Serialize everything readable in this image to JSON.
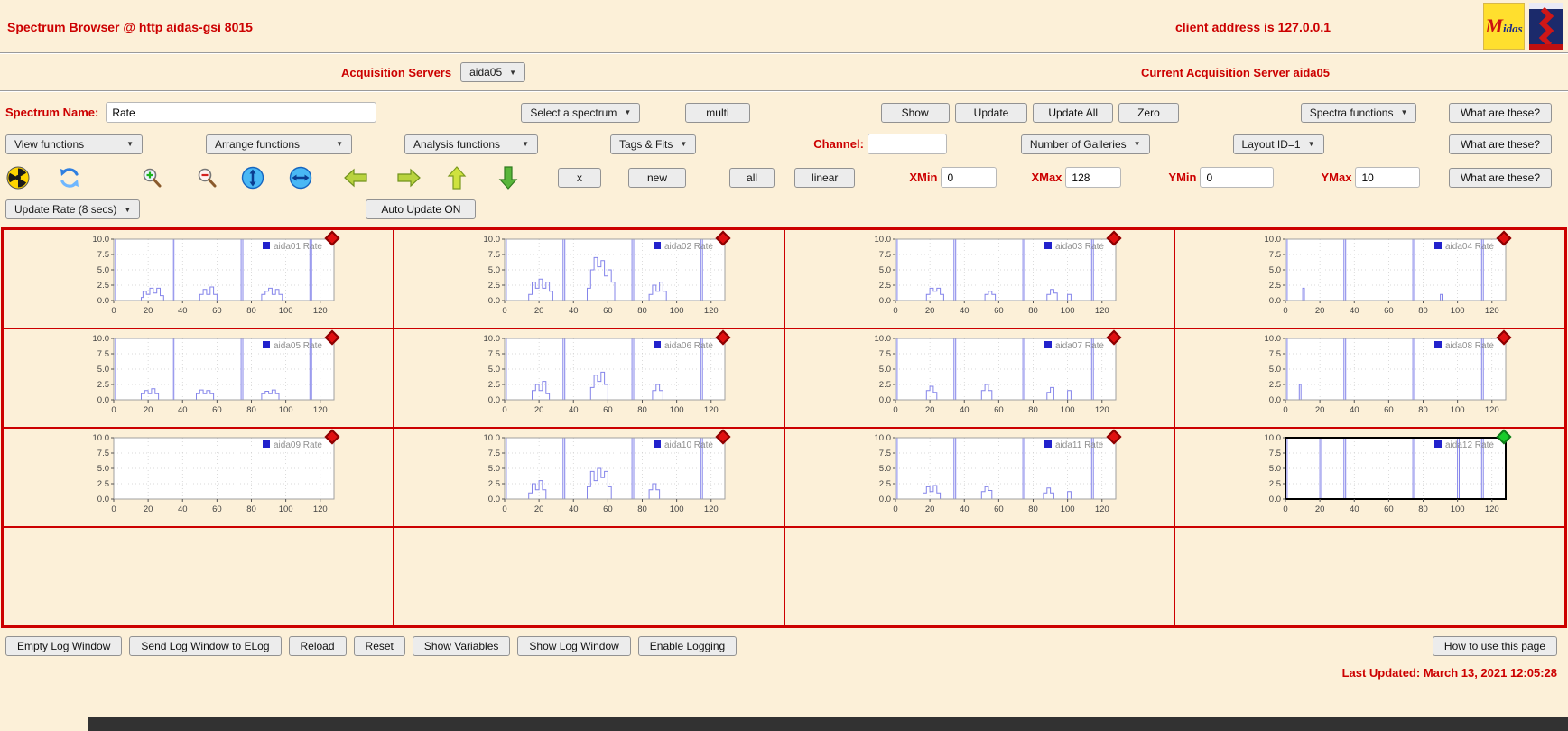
{
  "header": {
    "title": "Spectrum Browser @ http aidas-gsi 8015",
    "client_address": "client address is 127.0.0.1",
    "midas_logo_text": "Midas"
  },
  "icons": {
    "chevron_down": "▼",
    "radiation": "radiation-trefoil",
    "refresh": "circular-arrows",
    "zoom_in": "magnifier-plus",
    "zoom_out": "magnifier-minus",
    "unzoom_y": "↕",
    "unzoom_x": "↔",
    "shift_left": "left-block-arrow",
    "shift_right": "right-block-arrow",
    "shift_up": "up-block-arrow",
    "shift_down": "down-block-arrow"
  },
  "acquisition": {
    "label": "Acquisition Servers",
    "selected_server": "aida05",
    "current_text": "Current Acquisition Server aida05"
  },
  "spectrum_row": {
    "name_label": "Spectrum Name:",
    "name_value": "Rate",
    "select_spectrum": "Select a spectrum",
    "multi": "multi",
    "show": "Show",
    "update": "Update",
    "update_all": "Update All",
    "zero": "Zero",
    "spectra_functions": "Spectra functions",
    "what_are_these": "What are these?"
  },
  "functions_row": {
    "view_functions": "View functions",
    "arrange_functions": "Arrange functions",
    "analysis_functions": "Analysis functions",
    "tags_fits": "Tags & Fits",
    "channel_label": "Channel:",
    "channel_value": "",
    "number_of_galleries": "Number of Galleries",
    "layout_id": "Layout ID=1",
    "what_are_these": "What are these?"
  },
  "toolbar": {
    "x": "x",
    "new": "new",
    "all": "all",
    "linear": "linear",
    "xmin_label": "XMin",
    "xmin_value": "0",
    "xmax_label": "XMax",
    "xmax_value": "128",
    "ymin_label": "YMin",
    "ymin_value": "0",
    "ymax_label": "YMax",
    "ymax_value": "10",
    "what_are_these": "What are these?"
  },
  "update_row": {
    "update_rate": "Update Rate (8 secs)",
    "auto_update": "Auto Update ON"
  },
  "footer": {
    "buttons": [
      "Empty Log Window",
      "Send Log Window to ELog",
      "Reload",
      "Reset",
      "Show Variables",
      "Show Log Window",
      "Enable Logging"
    ],
    "help_button": "How to use this page",
    "last_updated": "Last Updated: March 13, 2021 12:05:28"
  },
  "chart_data": {
    "type": "step-line",
    "xlim": [
      0,
      128
    ],
    "ylim": [
      0,
      10
    ],
    "xticks": [
      0,
      20,
      40,
      60,
      80,
      100,
      120
    ],
    "yticks": [
      0,
      2.5,
      5,
      7.5,
      10
    ],
    "xlabel": "",
    "ylabel": "",
    "grid": true,
    "legend_position": "top-right",
    "line_color": "#8484ea",
    "legend_square_color": "#2222cc",
    "marker_colors": {
      "red": "#e01010",
      "green": "#18cc2a"
    },
    "empty_cells": 4,
    "panels": [
      {
        "name": "aida01",
        "legend": "aida01 Rate",
        "marker": "red",
        "selected": false,
        "points": [
          [
            0,
            10
          ],
          [
            1,
            0
          ],
          [
            16,
            0.5
          ],
          [
            17,
            1.5
          ],
          [
            19,
            1
          ],
          [
            21,
            2
          ],
          [
            23,
            1.2
          ],
          [
            25,
            2
          ],
          [
            27,
            0.8
          ],
          [
            29,
            0
          ],
          [
            34,
            10
          ],
          [
            35,
            0
          ],
          [
            50,
            1
          ],
          [
            52,
            1.8
          ],
          [
            54,
            1
          ],
          [
            56,
            2.2
          ],
          [
            58,
            1
          ],
          [
            60,
            0
          ],
          [
            74,
            10
          ],
          [
            75,
            0
          ],
          [
            86,
            1
          ],
          [
            88,
            1.5
          ],
          [
            90,
            2
          ],
          [
            92,
            1
          ],
          [
            94,
            1.8
          ],
          [
            96,
            1
          ],
          [
            98,
            0
          ],
          [
            114,
            10
          ],
          [
            115,
            0
          ],
          [
            128,
            0
          ]
        ]
      },
      {
        "name": "aida02",
        "legend": "aida02 Rate",
        "marker": "red",
        "selected": false,
        "points": [
          [
            0,
            10
          ],
          [
            1,
            0
          ],
          [
            14,
            1
          ],
          [
            16,
            3
          ],
          [
            18,
            2
          ],
          [
            20,
            3.5
          ],
          [
            22,
            2
          ],
          [
            24,
            3
          ],
          [
            26,
            1.5
          ],
          [
            28,
            0
          ],
          [
            34,
            10
          ],
          [
            35,
            0
          ],
          [
            48,
            2
          ],
          [
            50,
            5
          ],
          [
            52,
            7
          ],
          [
            54,
            5.5
          ],
          [
            56,
            6.5
          ],
          [
            58,
            4
          ],
          [
            60,
            5
          ],
          [
            62,
            3
          ],
          [
            64,
            0
          ],
          [
            74,
            10
          ],
          [
            75,
            0
          ],
          [
            84,
            1
          ],
          [
            86,
            2.5
          ],
          [
            88,
            1.5
          ],
          [
            90,
            3
          ],
          [
            92,
            1.5
          ],
          [
            94,
            0
          ],
          [
            114,
            10
          ],
          [
            115,
            0
          ],
          [
            128,
            0
          ]
        ]
      },
      {
        "name": "aida03",
        "legend": "aida03 Rate",
        "marker": "red",
        "selected": false,
        "points": [
          [
            0,
            10
          ],
          [
            1,
            0
          ],
          [
            18,
            1
          ],
          [
            20,
            2
          ],
          [
            22,
            1.5
          ],
          [
            24,
            2
          ],
          [
            26,
            1
          ],
          [
            28,
            0
          ],
          [
            34,
            10
          ],
          [
            35,
            0
          ],
          [
            52,
            1
          ],
          [
            54,
            1.5
          ],
          [
            56,
            1
          ],
          [
            58,
            0
          ],
          [
            74,
            10
          ],
          [
            75,
            0
          ],
          [
            88,
            1
          ],
          [
            90,
            1.8
          ],
          [
            92,
            1.2
          ],
          [
            94,
            0
          ],
          [
            100,
            1
          ],
          [
            102,
            0
          ],
          [
            114,
            10
          ],
          [
            115,
            0
          ],
          [
            128,
            0
          ]
        ]
      },
      {
        "name": "aida04",
        "legend": "aida04 Rate",
        "marker": "red",
        "selected": false,
        "points": [
          [
            0,
            10
          ],
          [
            1,
            0
          ],
          [
            10,
            2
          ],
          [
            11,
            0
          ],
          [
            34,
            10
          ],
          [
            35,
            0
          ],
          [
            74,
            10
          ],
          [
            75,
            0
          ],
          [
            90,
            1
          ],
          [
            91,
            0
          ],
          [
            114,
            10
          ],
          [
            115,
            0
          ],
          [
            128,
            0
          ]
        ]
      },
      {
        "name": "aida05",
        "legend": "aida05 Rate",
        "marker": "red",
        "selected": false,
        "points": [
          [
            0,
            10
          ],
          [
            1,
            0
          ],
          [
            16,
            1
          ],
          [
            18,
            1.5
          ],
          [
            20,
            1
          ],
          [
            22,
            1.8
          ],
          [
            24,
            1
          ],
          [
            26,
            0
          ],
          [
            34,
            10
          ],
          [
            35,
            0
          ],
          [
            48,
            1
          ],
          [
            50,
            1.6
          ],
          [
            52,
            1
          ],
          [
            54,
            1.5
          ],
          [
            56,
            1
          ],
          [
            58,
            0
          ],
          [
            74,
            10
          ],
          [
            75,
            0
          ],
          [
            86,
            1
          ],
          [
            88,
            1.4
          ],
          [
            90,
            1
          ],
          [
            92,
            1.6
          ],
          [
            94,
            1
          ],
          [
            96,
            0
          ],
          [
            114,
            10
          ],
          [
            115,
            0
          ],
          [
            128,
            0
          ]
        ]
      },
      {
        "name": "aida06",
        "legend": "aida06 Rate",
        "marker": "red",
        "selected": false,
        "points": [
          [
            0,
            10
          ],
          [
            1,
            0
          ],
          [
            16,
            1.5
          ],
          [
            18,
            2.5
          ],
          [
            20,
            1.5
          ],
          [
            22,
            3
          ],
          [
            24,
            1
          ],
          [
            26,
            0
          ],
          [
            34,
            10
          ],
          [
            35,
            0
          ],
          [
            50,
            2
          ],
          [
            52,
            4
          ],
          [
            54,
            3
          ],
          [
            56,
            4.5
          ],
          [
            58,
            2.5
          ],
          [
            60,
            0
          ],
          [
            74,
            10
          ],
          [
            75,
            0
          ],
          [
            86,
            1.5
          ],
          [
            88,
            2.5
          ],
          [
            90,
            1.5
          ],
          [
            92,
            0
          ],
          [
            114,
            10
          ],
          [
            115,
            0
          ],
          [
            128,
            0
          ]
        ]
      },
      {
        "name": "aida07",
        "legend": "aida07 Rate",
        "marker": "red",
        "selected": false,
        "points": [
          [
            0,
            10
          ],
          [
            1,
            0
          ],
          [
            18,
            1.5
          ],
          [
            20,
            2.2
          ],
          [
            22,
            1.2
          ],
          [
            24,
            0
          ],
          [
            34,
            10
          ],
          [
            35,
            0
          ],
          [
            50,
            1.5
          ],
          [
            52,
            2.5
          ],
          [
            54,
            1.5
          ],
          [
            56,
            0
          ],
          [
            74,
            10
          ],
          [
            75,
            0
          ],
          [
            88,
            1.2
          ],
          [
            90,
            2
          ],
          [
            92,
            0
          ],
          [
            100,
            1.5
          ],
          [
            102,
            0
          ],
          [
            114,
            10
          ],
          [
            115,
            0
          ],
          [
            128,
            0
          ]
        ]
      },
      {
        "name": "aida08",
        "legend": "aida08 Rate",
        "marker": "red",
        "selected": false,
        "points": [
          [
            0,
            10
          ],
          [
            1,
            0
          ],
          [
            8,
            2.5
          ],
          [
            9,
            0
          ],
          [
            34,
            10
          ],
          [
            35,
            0
          ],
          [
            74,
            10
          ],
          [
            75,
            0
          ],
          [
            114,
            10
          ],
          [
            115,
            0
          ],
          [
            128,
            0
          ]
        ]
      },
      {
        "name": "aida09",
        "legend": "aida09 Rate",
        "marker": "red",
        "selected": false,
        "points": []
      },
      {
        "name": "aida10",
        "legend": "aida10 Rate",
        "marker": "red",
        "selected": false,
        "points": [
          [
            0,
            10
          ],
          [
            1,
            0
          ],
          [
            14,
            1
          ],
          [
            16,
            2.5
          ],
          [
            18,
            1.5
          ],
          [
            20,
            3
          ],
          [
            22,
            1.5
          ],
          [
            24,
            0
          ],
          [
            34,
            10
          ],
          [
            35,
            0
          ],
          [
            48,
            2
          ],
          [
            50,
            4.5
          ],
          [
            52,
            3
          ],
          [
            54,
            5
          ],
          [
            56,
            3.5
          ],
          [
            58,
            4.5
          ],
          [
            60,
            2
          ],
          [
            62,
            0
          ],
          [
            74,
            10
          ],
          [
            75,
            0
          ],
          [
            84,
            1.5
          ],
          [
            86,
            2.5
          ],
          [
            88,
            1.5
          ],
          [
            90,
            0
          ],
          [
            114,
            10
          ],
          [
            115,
            0
          ],
          [
            128,
            0
          ]
        ]
      },
      {
        "name": "aida11",
        "legend": "aida11 Rate",
        "marker": "red",
        "selected": false,
        "points": [
          [
            0,
            10
          ],
          [
            1,
            0
          ],
          [
            16,
            1
          ],
          [
            18,
            2
          ],
          [
            20,
            1.2
          ],
          [
            22,
            2.2
          ],
          [
            24,
            1
          ],
          [
            26,
            0
          ],
          [
            34,
            10
          ],
          [
            35,
            0
          ],
          [
            50,
            1.2
          ],
          [
            52,
            2
          ],
          [
            54,
            1.4
          ],
          [
            56,
            0
          ],
          [
            74,
            10
          ],
          [
            75,
            0
          ],
          [
            86,
            1
          ],
          [
            88,
            1.8
          ],
          [
            90,
            1
          ],
          [
            92,
            0
          ],
          [
            100,
            1.2
          ],
          [
            102,
            0
          ],
          [
            114,
            10
          ],
          [
            115,
            0
          ],
          [
            128,
            0
          ]
        ]
      },
      {
        "name": "aida12",
        "legend": "aida12 Rate",
        "marker": "green",
        "selected": true,
        "points": [
          [
            0,
            10
          ],
          [
            1,
            0
          ],
          [
            20,
            10
          ],
          [
            21,
            0
          ],
          [
            34,
            10
          ],
          [
            35,
            0
          ],
          [
            74,
            10
          ],
          [
            75,
            0
          ],
          [
            100,
            10
          ],
          [
            101,
            0
          ],
          [
            114,
            10
          ],
          [
            115,
            0
          ],
          [
            128,
            0
          ]
        ]
      }
    ]
  }
}
